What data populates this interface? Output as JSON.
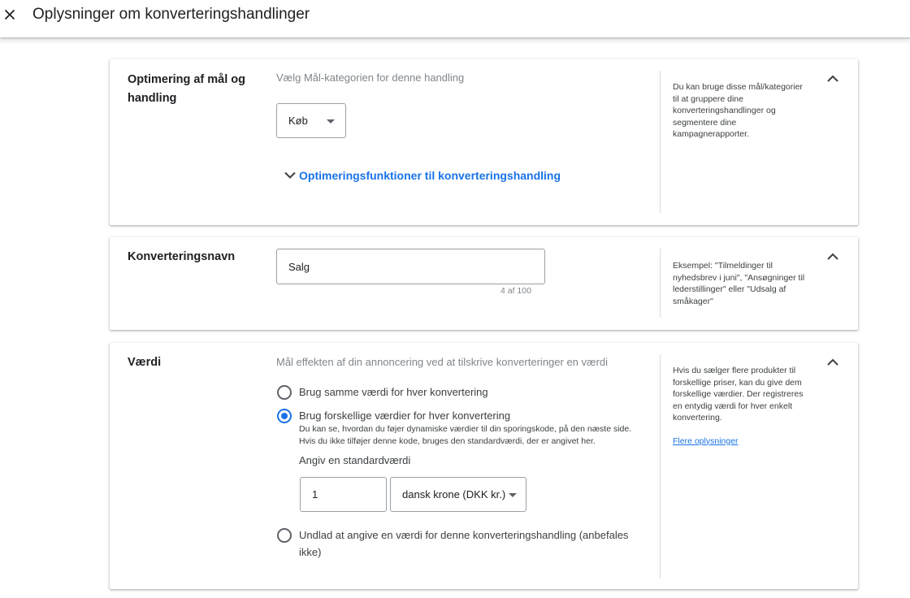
{
  "header": {
    "title": "Oplysninger om konverteringshandlinger",
    "close_icon": "close-icon"
  },
  "goal_card": {
    "label": "Optimering af mål og handling",
    "hint": "Vælg Mål-kategorien for denne handling",
    "category_select": {
      "value": "Køb"
    },
    "optimization_link": "Optimeringsfunktioner til konverteringshandling",
    "help": "Du kan bruge disse mål/kategorier til at gruppere dine konverteringshandlinger og segmentere dine kampagnerapporter."
  },
  "name_card": {
    "label": "Konverteringsnavn",
    "name_input": {
      "value": "Salg"
    },
    "counter": "4 af 100",
    "help": "Eksempel: \"Tilmeldinger til nyhedsbrev i juni\", \"Ansøgninger til lederstillinger\" eller \"Udsalg af småkager\""
  },
  "value_card": {
    "label": "Værdi",
    "hint": "Mål effekten af din annoncering ved at tilskrive konverteringer en værdi",
    "options": [
      {
        "label": "Brug samme værdi for hver konvertering",
        "checked": false
      },
      {
        "label": "Brug forskellige værdier for hver konvertering",
        "checked": true,
        "description": "Du kan se, hvordan du føjer dynamiske værdier til din sporingskode, på den næste side. Hvis du ikke tilføjer denne kode, bruges den standardværdi, der er angivet her."
      },
      {
        "label": "Undlad at angive en værdi for denne konverteringshandling (anbefales ikke)",
        "checked": false
      }
    ],
    "default_value_label": "Angiv en standardværdi",
    "default_value": "1",
    "currency": "dansk krone (DKK kr.)",
    "help": "Hvis du sælger flere produkter til forskellige priser, kan du give dem forskellige værdier. Der registreres en entydig værdi for hver enkelt konvertering.",
    "help_link": "Flere oplysninger"
  },
  "colors": {
    "accent": "#1a73e8",
    "text": "#202124",
    "muted": "#80868b",
    "border": "#9aa0a6",
    "divider": "#dadce0"
  }
}
